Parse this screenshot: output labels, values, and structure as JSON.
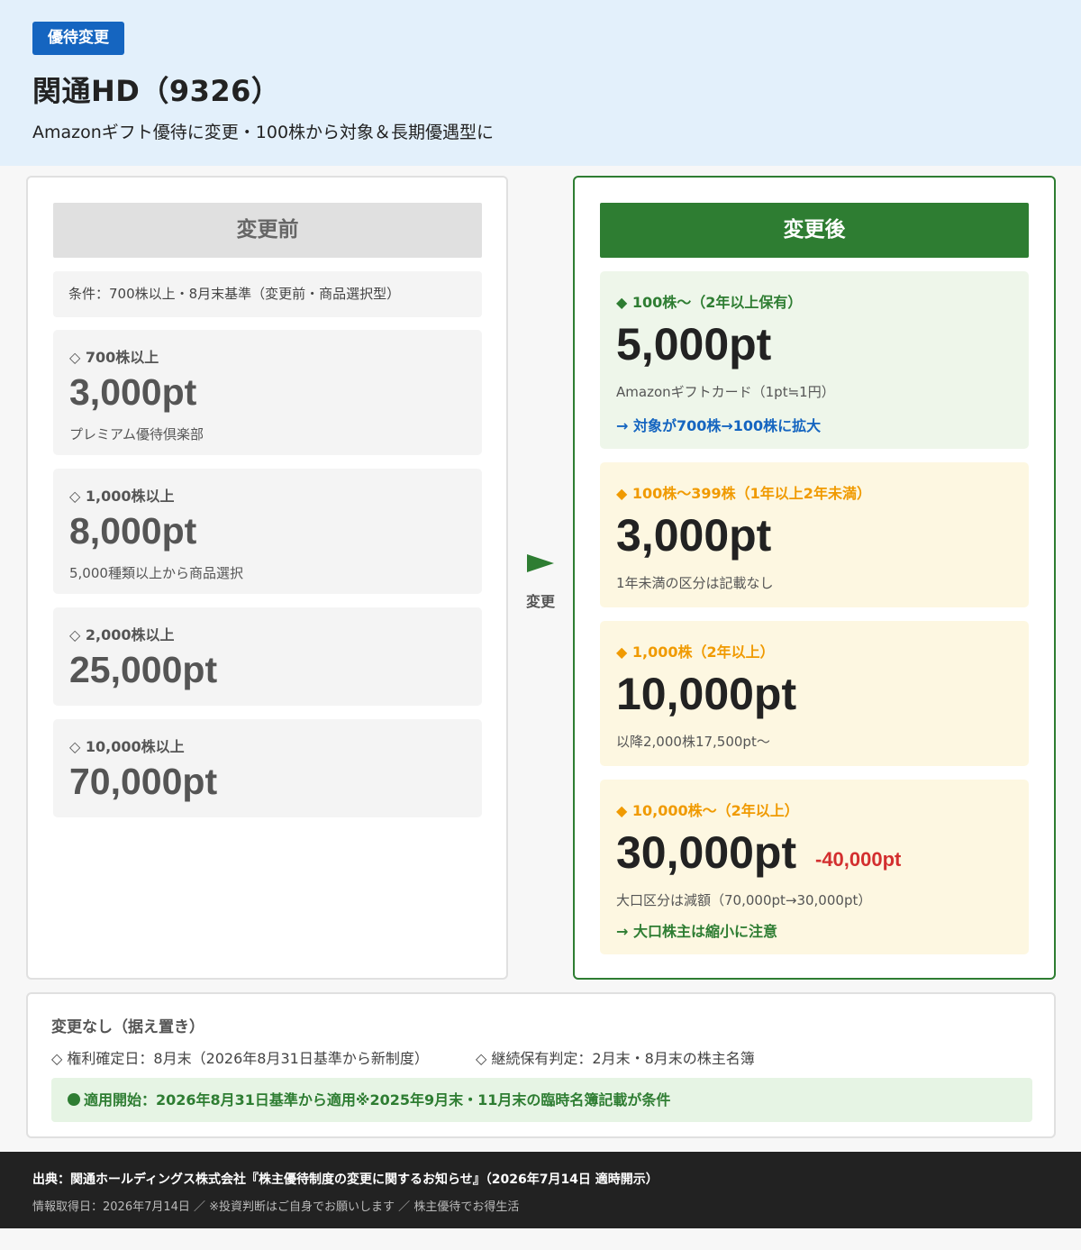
{
  "header": {
    "badge": "優待変更",
    "title": "関通HD（9326）",
    "subtitle": "Amazonギフト優待に変更・100株から対象＆長期優遇型に"
  },
  "before": {
    "heading": "変更前",
    "condition": "条件：700株以上・8月末基準（変更前・商品選択型）",
    "tiers": [
      {
        "label": "◇ 700株以上",
        "value": "3,000pt",
        "note": "プレミアム優待倶楽部"
      },
      {
        "label": "◇ 1,000株以上",
        "value": "8,000pt",
        "note": "5,000種類以上から商品選択"
      },
      {
        "label": "◇ 2,000株以上",
        "value": "25,000pt"
      },
      {
        "label": "◇ 10,000株以上",
        "value": "70,000pt"
      }
    ]
  },
  "arrow": {
    "label": "変更",
    "icon": "right-triangle-arrow-icon"
  },
  "after": {
    "heading": "変更後",
    "tiers": [
      {
        "label": "◆ 100株〜（2年以上保有）",
        "value": "5,000pt",
        "note": "Amazonギフトカード（1pt≒1円）",
        "link": "→ 対象が700株→100株に拡大"
      },
      {
        "label": "◆ 100株〜399株（1年以上2年未満）",
        "value": "3,000pt",
        "note": "1年未満の区分は記載なし"
      },
      {
        "label": "◆ 1,000株（2年以上）",
        "value": "10,000pt",
        "note": "以降2,000株17,500pt〜"
      },
      {
        "label": "◆ 10,000株〜（2年以上）",
        "value": "30,000pt",
        "diff": "-40,000pt",
        "note": "大口区分は減額（70,000pt→30,000pt）",
        "link": "→ 大口株主は縮小に注意"
      }
    ]
  },
  "unchanged": {
    "title": "変更なし（据え置き）",
    "items": [
      "◇ 権利確定日：8月末（2026年8月31日基準から新制度）",
      "◇ 継続保有判定：2月末・8月末の株主名簿"
    ],
    "start": "適用開始：2026年8月31日基準から適用※2025年9月末・11月末の臨時名簿記載が条件"
  },
  "footer": {
    "source": "出典：関通ホールディングス株式会社『株主優待制度の変更に関するお知らせ』（2026年7月14日 適時開示）",
    "info": "情報取得日：2026年7月14日 ／ ※投資判断はご自身でお願いします ／ 株主優待でお得生活"
  },
  "colors": {
    "header_bg": "#e3f0fb",
    "badge": "#1565c0",
    "after_accent": "#2e7d32",
    "orange_label": "#f09a00",
    "diff_red": "#d32f2f",
    "footer_bg": "#222222"
  }
}
